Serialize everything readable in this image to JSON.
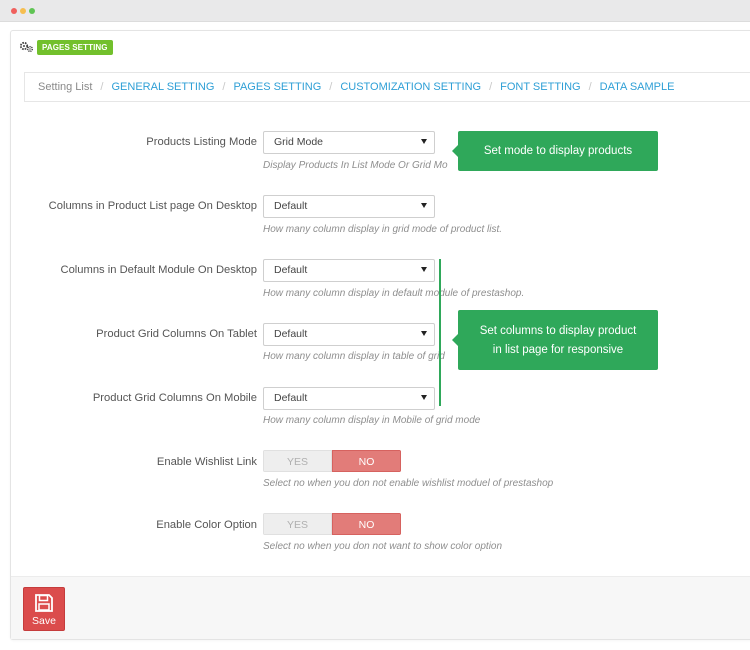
{
  "header": {
    "badge": "PAGES SETTING",
    "icon": "gears-icon"
  },
  "breadcrumb": {
    "first": "Setting List",
    "links": [
      "GENERAL SETTING",
      "PAGES SETTING",
      "CUSTOMIZATION SETTING",
      "FONT SETTING",
      "DATA SAMPLE"
    ]
  },
  "fields": {
    "listing_mode": {
      "label": "Products Listing Mode",
      "value": "Grid Mode",
      "help": "Display Products In List Mode Or Grid Mo"
    },
    "cols_desktop": {
      "label": "Columns in Product List page On Desktop",
      "value": "Default",
      "help": "How many column display in grid mode of product list."
    },
    "cols_module": {
      "label": "Columns in Default Module On Desktop",
      "value": "Default",
      "help": "How many column display in default module of prestashop."
    },
    "cols_tablet": {
      "label": "Product Grid Columns On Tablet",
      "value": "Default",
      "help": "How many column display in table of grid"
    },
    "cols_mobile": {
      "label": "Product Grid Columns On Mobile",
      "value": "Default",
      "help": "How many column display in Mobile of grid mode"
    },
    "wishlist": {
      "label": "Enable Wishlist Link",
      "yes": "YES",
      "no": "NO",
      "selected": "NO",
      "help": "Select no when you don not enable wishlist moduel of prestashop"
    },
    "color_option": {
      "label": "Enable Color Option",
      "yes": "YES",
      "no": "NO",
      "selected": "NO",
      "help": "Select no when you don not want to show color option"
    }
  },
  "callouts": {
    "mode": "Set mode to display products",
    "columns_line1": "Set columns to display product",
    "columns_line2": "in list page for responsive"
  },
  "footer": {
    "save_label": "Save",
    "icon": "floppy-icon"
  },
  "colors": {
    "accent_green": "#2fa85a",
    "badge_green": "#72c02c",
    "link_blue": "#2e9fd6",
    "save_red": "#db4c4c",
    "no_red": "#e27c79"
  }
}
